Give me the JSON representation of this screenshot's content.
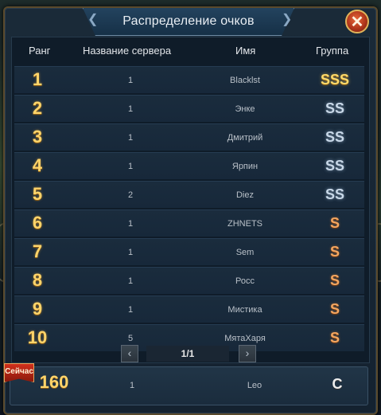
{
  "window": {
    "title": "Распределение очков",
    "close_label": "✕"
  },
  "columns": {
    "rank": "Ранг",
    "server": "Название сервера",
    "name": "Имя",
    "group": "Группа"
  },
  "rows": [
    {
      "rank": "1",
      "server": "1",
      "name": "Blacklst",
      "group": "SSS",
      "tier": "sss"
    },
    {
      "rank": "2",
      "server": "1",
      "name": "Энке",
      "group": "SS",
      "tier": "ss"
    },
    {
      "rank": "3",
      "server": "1",
      "name": "Дмитрий",
      "group": "SS",
      "tier": "ss"
    },
    {
      "rank": "4",
      "server": "1",
      "name": "Ярпин",
      "group": "SS",
      "tier": "ss"
    },
    {
      "rank": "5",
      "server": "2",
      "name": "Diez",
      "group": "SS",
      "tier": "ss"
    },
    {
      "rank": "6",
      "server": "1",
      "name": "ZHNETS",
      "group": "S",
      "tier": "s"
    },
    {
      "rank": "7",
      "server": "1",
      "name": "Sem",
      "group": "S",
      "tier": "s"
    },
    {
      "rank": "8",
      "server": "1",
      "name": "Росс",
      "group": "S",
      "tier": "s"
    },
    {
      "rank": "9",
      "server": "1",
      "name": "Мистика",
      "group": "S",
      "tier": "s"
    },
    {
      "rank": "10",
      "server": "5",
      "name": "МятаХаря",
      "group": "S",
      "tier": "s"
    }
  ],
  "pager": {
    "text": "1/1",
    "prev_icon": "chevron-left-icon",
    "next_icon": "chevron-right-icon"
  },
  "self": {
    "badge": "Сейчас",
    "rank": "160",
    "server": "1",
    "name": "Leo",
    "group": "C"
  },
  "colors": {
    "gold": "#ffd46a",
    "silver": "#c8d8e8",
    "bronze": "#f3a660",
    "close": "#b0361b"
  }
}
